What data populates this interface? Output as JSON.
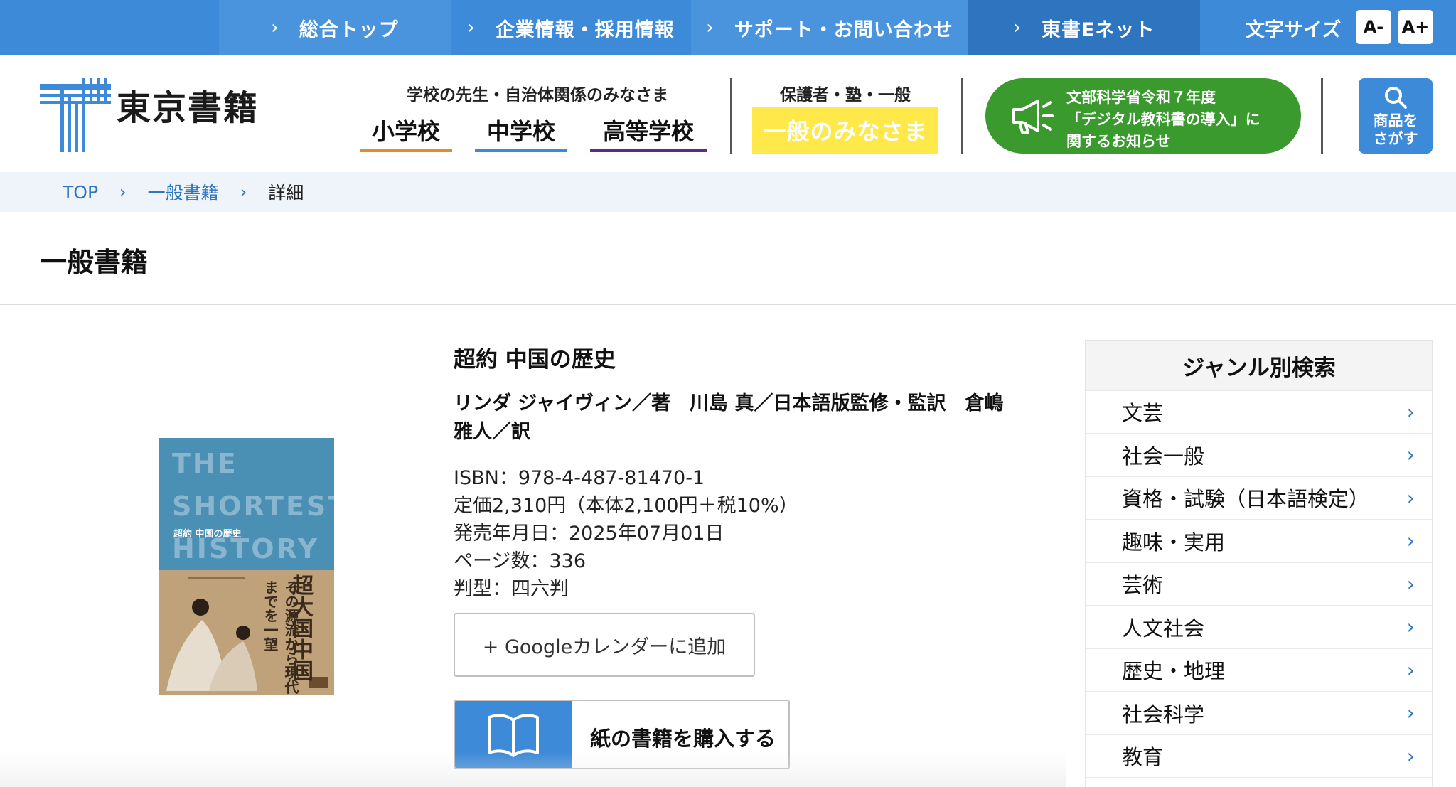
{
  "topnav": {
    "items": [
      "総合トップ",
      "企業情報・採用情報",
      "サポート・お問い合わせ",
      "東書Eネット"
    ],
    "fontsize_label": "文字サイズ",
    "fontsize_minus": "A-",
    "fontsize_plus": "A+"
  },
  "header": {
    "logo_text": "東京書籍",
    "teachers_label": "学校の先生・自治体関係のみなさま",
    "schools": [
      "小学校",
      "中学校",
      "高等学校"
    ],
    "school_colors": [
      "#e58a2c",
      "#3d8ad8",
      "#5b2c8f"
    ],
    "general_label": "保護者・塾・一般",
    "general_button": "一般のみなさま",
    "notice_lines": [
      "文部科学省令和７年度",
      "「デジタル教科書の導入」に",
      "関するお知らせ"
    ],
    "search_lines": [
      "商品を",
      "さがす"
    ]
  },
  "breadcrumb": {
    "top": "TOP",
    "category": "一般書籍",
    "current": "詳細"
  },
  "page_title": "一般書籍",
  "book": {
    "cover": {
      "title_en": [
        "THE",
        "SHORTEST",
        "HISTORY"
      ],
      "subtitle": "超約 中国の歴史",
      "vertical_main": "超大国中国",
      "vertical_sub": "その源流から現代までを一望"
    },
    "title": "超約 中国の歴史",
    "authors": "リンダ ジャイヴィン／著　川島 真／日本語版監修・監訳　倉嶋雅人／訳",
    "isbn": "ISBN：978-4-487-81470-1",
    "price": "定価2,310円（本体2,100円＋税10%）",
    "release": "発売年月日：2025年07月01日",
    "pages": "ページ数：336",
    "format": "判型：四六判",
    "gcal_button": "+ Googleカレンダーに追加",
    "buy_button": "紙の書籍を購入する"
  },
  "sidebar": {
    "title": "ジャンル別検索",
    "items": [
      "文芸",
      "社会一般",
      "資格・試験（日本語検定）",
      "趣味・実用",
      "芸術",
      "人文社会",
      "歴史・地理",
      "社会科学",
      "教育"
    ]
  }
}
